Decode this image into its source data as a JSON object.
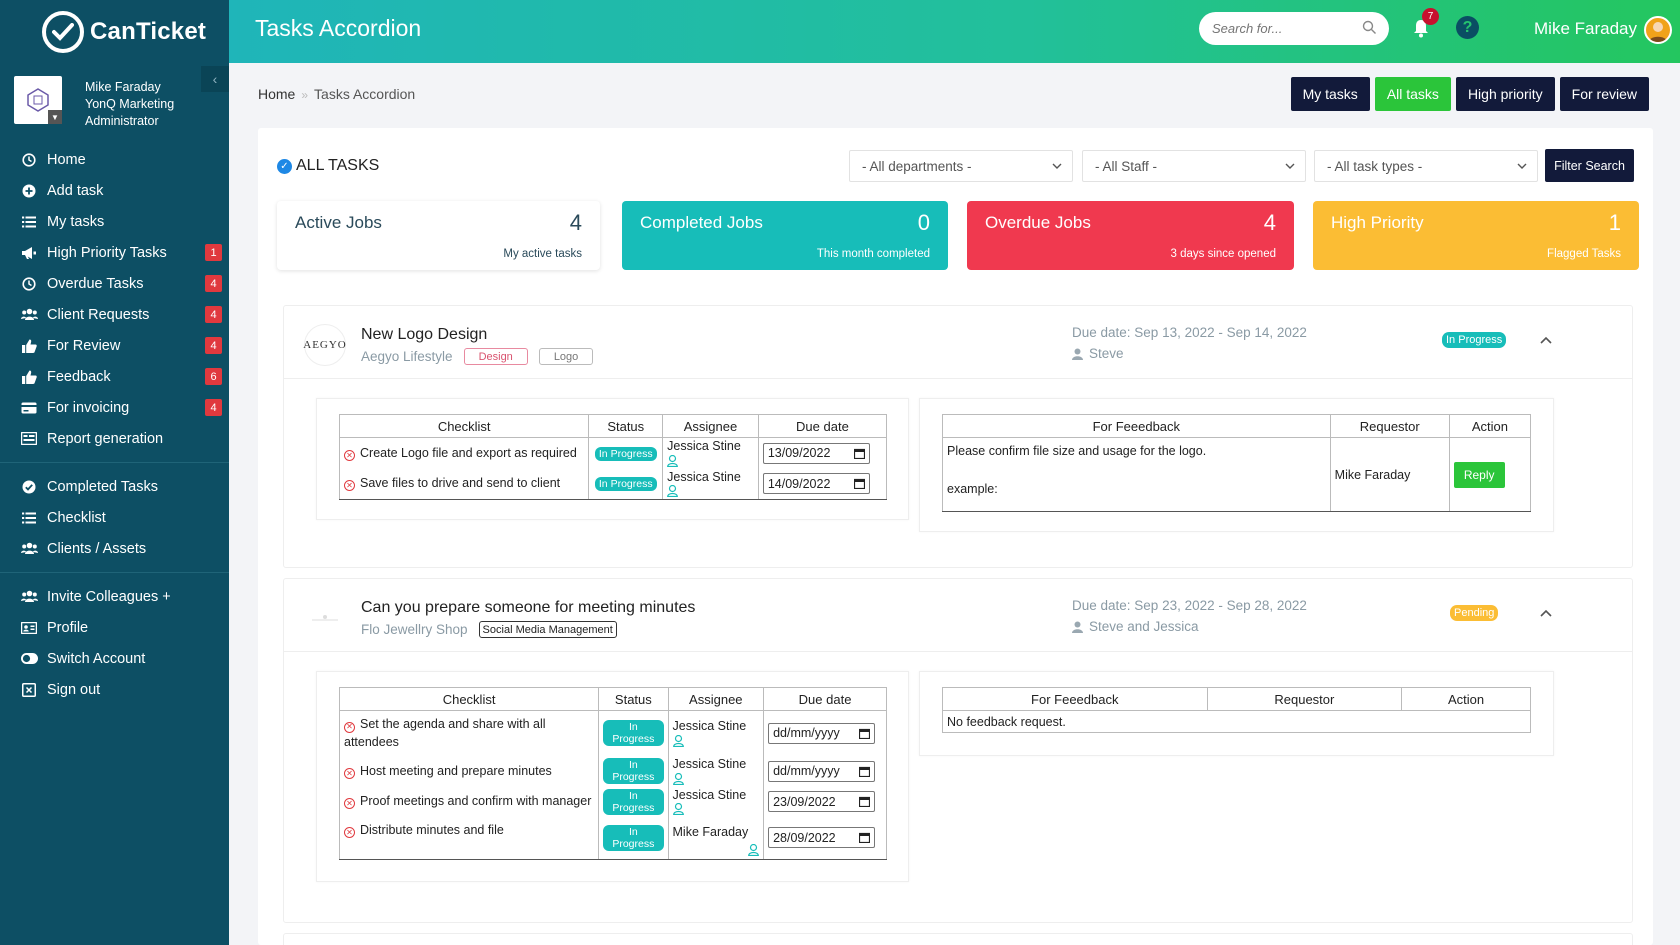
{
  "app": {
    "logo_text": "CanTicket"
  },
  "profile": {
    "name": "Mike Faraday",
    "company": "YonQ Marketing",
    "role": "Administrator"
  },
  "sidebar": {
    "group1": [
      {
        "label": "Home",
        "icon": "clock-icon"
      },
      {
        "label": "Add task",
        "icon": "plus-circle-icon"
      },
      {
        "label": "My tasks",
        "icon": "list-icon"
      },
      {
        "label": "High Priority Tasks",
        "icon": "megaphone-icon",
        "badge": "1"
      },
      {
        "label": "Overdue Tasks",
        "icon": "clock-icon",
        "badge": "4"
      },
      {
        "label": "Client Requests",
        "icon": "users-icon",
        "badge": "4"
      },
      {
        "label": "For Review",
        "icon": "thumbs-up-icon",
        "badge": "4"
      },
      {
        "label": "Feedback",
        "icon": "thumbs-up-icon",
        "badge": "6"
      },
      {
        "label": "For invoicing",
        "icon": "card-icon",
        "badge": "4"
      },
      {
        "label": "Report generation",
        "icon": "report-icon"
      }
    ],
    "group2": [
      {
        "label": "Completed Tasks",
        "icon": "check-circle-icon"
      },
      {
        "label": "Checklist",
        "icon": "list-icon"
      },
      {
        "label": "Clients / Assets",
        "icon": "users-icon"
      }
    ],
    "group3": [
      {
        "label": "Invite Colleagues +",
        "icon": "users-icon"
      },
      {
        "label": "Profile",
        "icon": "id-card-icon"
      },
      {
        "label": "Switch Account",
        "icon": "toggle-icon"
      },
      {
        "label": "Sign out",
        "icon": "sign-out-icon"
      }
    ]
  },
  "header": {
    "title": "Tasks Accordion",
    "search_placeholder": "Search for...",
    "notifications": "7",
    "help": "?",
    "user_name": "Mike Faraday"
  },
  "breadcrumb": {
    "home": "Home",
    "sep": "»",
    "current": "Tasks Accordion"
  },
  "top_buttons": [
    "My tasks",
    "All tasks",
    "High priority",
    "For review"
  ],
  "filters": {
    "title": "ALL TASKS",
    "departments": "- All departments -",
    "staff": "- All Staff -",
    "task_types": "- All task types -",
    "button": "Filter Search"
  },
  "stats": [
    {
      "label": "Active Jobs",
      "value": "4",
      "sub": "My active tasks"
    },
    {
      "label": "Completed Jobs",
      "value": "0",
      "sub": "This month completed"
    },
    {
      "label": "Overdue Jobs",
      "value": "4",
      "sub": "3 days since opened"
    },
    {
      "label": "High Priority",
      "value": "1",
      "sub": "Flagged Tasks"
    }
  ],
  "colors": {
    "teal": "#17bdb9",
    "red": "#f0394f",
    "yellow": "#fbbd34",
    "green": "#2bc53a",
    "navy": "#121a3a",
    "sidebar": "#0d4f64"
  },
  "tasks": [
    {
      "brand": "AEGYO",
      "title": "New Logo Design",
      "client": "Aegyo Lifestyle",
      "tags": [
        "Design",
        "Logo"
      ],
      "due": "Due date: Sep 13, 2022 - Sep 14, 2022",
      "assigned": "Steve",
      "status": "In Progress",
      "headers": {
        "checklist": "Checklist",
        "status": "Status",
        "assignee": "Assignee",
        "due": "Due date"
      },
      "checklist": [
        {
          "item": "Create Logo file and export as required",
          "status": "In Progress",
          "assignee": "Jessica Stine",
          "date": "13/09/2022"
        },
        {
          "item": "Save files to drive and send to client",
          "status": "In Progress",
          "assignee": "Jessica Stine",
          "date": "14/09/2022"
        }
      ],
      "feedback_headers": {
        "feedback": "For Feeedback",
        "requestor": "Requestor",
        "action": "Action"
      },
      "feedback": {
        "line1": "Please confirm file size and usage for the logo.",
        "line2": "example:",
        "requestor": "Mike Faraday",
        "action": "Reply"
      }
    },
    {
      "title": "Can you prepare someone for meeting minutes",
      "client": "Flo Jewellry Shop",
      "tags": [
        "Social Media Management"
      ],
      "due": "Due date: Sep 23, 2022 - Sep 28, 2022",
      "assigned": "Steve and Jessica",
      "status": "Pending",
      "headers": {
        "checklist": "Checklist",
        "status": "Status",
        "assignee": "Assignee",
        "due": "Due date"
      },
      "checklist": [
        {
          "item": "Set the agenda and share with all attendees",
          "status": "In Progress",
          "assignee": "Jessica Stine",
          "date": "dd/mm/yyyy"
        },
        {
          "item": "Host meeting and prepare minutes",
          "status": "In Progress",
          "assignee": "Jessica Stine",
          "date": "dd/mm/yyyy"
        },
        {
          "item": "Proof meetings and confirm with manager",
          "status": "In Progress",
          "assignee": "Jessica Stine",
          "date": "23/09/2022"
        },
        {
          "item": "Distribute minutes and file",
          "status": "In Progress",
          "assignee": "Mike Faraday",
          "date": "28/09/2022"
        }
      ],
      "feedback_headers": {
        "feedback": "For Feeedback",
        "requestor": "Requestor",
        "action": "Action"
      },
      "feedback": {
        "line1": "No feedback request."
      }
    }
  ]
}
